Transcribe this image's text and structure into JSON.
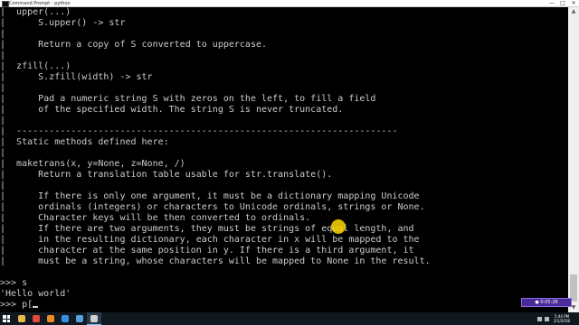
{
  "window": {
    "title": "Command Prompt - python",
    "controls": [
      "—",
      "□",
      "✕"
    ]
  },
  "console": {
    "lines": [
      "|  upper(...)",
      "|      S.upper() -> str",
      "|",
      "|      Return a copy of S converted to uppercase.",
      "|",
      "|  zfill(...)",
      "|      S.zfill(width) -> str",
      "|",
      "|      Pad a numeric string S with zeros on the left, to fill a field",
      "|      of the specified width. The string S is never truncated.",
      "|",
      "|  ----------------------------------------------------------------------",
      "|  Static methods defined here:",
      "|",
      "|  maketrans(x, y=None, z=None, /)",
      "|      Return a translation table usable for str.translate().",
      "|",
      "|      If there is only one argument, it must be a dictionary mapping Unicode",
      "|      ordinals (integers) or characters to Unicode ordinals, strings or None.",
      "|      Character keys will be then converted to ordinals.",
      "|      If there are two arguments, they must be strings of equal length, and",
      "|      in the resulting dictionary, each character in x will be mapped to the",
      "|      character at the same position in y. If there is a third argument, it",
      "|      must be a string, whose characters will be mapped to None in the result.",
      "",
      ">>> s",
      "'Hello world'",
      ">>> p["
    ],
    "text_color": "#cccccc",
    "background": "#000000"
  },
  "recorder": {
    "label": "● 0:05:28"
  },
  "taskbar": {
    "apps": [
      {
        "name": "file-explorer-icon",
        "color": "#e8b84a"
      },
      {
        "name": "chrome-icon",
        "color": "#e04a3a"
      },
      {
        "name": "firefox-icon",
        "color": "#f08a24"
      },
      {
        "name": "edge-icon",
        "color": "#3a8ee6"
      },
      {
        "name": "mail-icon",
        "color": "#5aa0e0"
      },
      {
        "name": "terminal-icon",
        "color": "#d0d0d0",
        "active": true
      }
    ],
    "clock_time": "5:44 PM",
    "clock_date": "2/1/2018"
  }
}
